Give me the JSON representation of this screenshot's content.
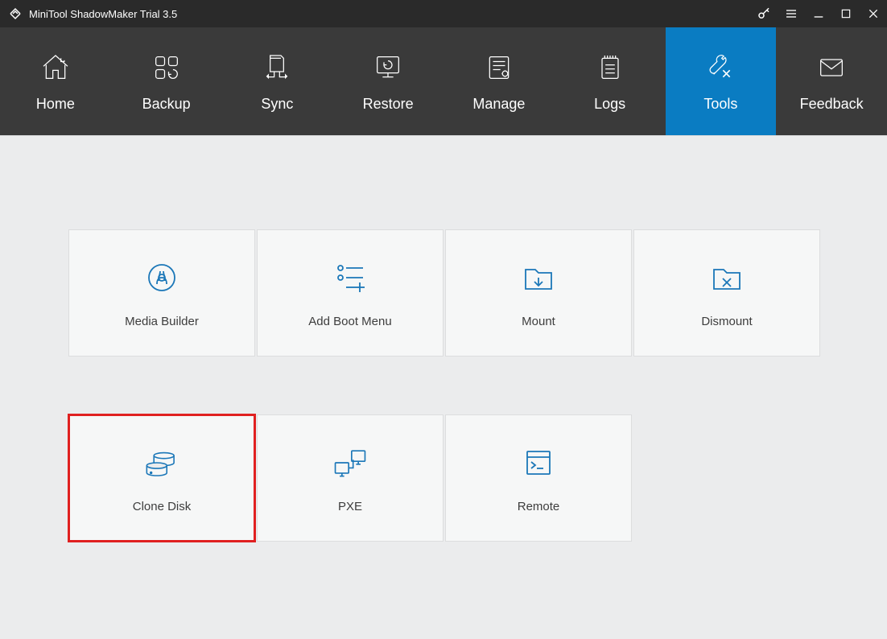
{
  "titlebar": {
    "title": "MiniTool ShadowMaker Trial 3.5"
  },
  "nav": {
    "items": [
      {
        "label": "Home"
      },
      {
        "label": "Backup"
      },
      {
        "label": "Sync"
      },
      {
        "label": "Restore"
      },
      {
        "label": "Manage"
      },
      {
        "label": "Logs"
      },
      {
        "label": "Tools"
      },
      {
        "label": "Feedback"
      }
    ],
    "active_index": 6
  },
  "tools": {
    "items": [
      {
        "label": "Media Builder"
      },
      {
        "label": "Add Boot Menu"
      },
      {
        "label": "Mount"
      },
      {
        "label": "Dismount"
      },
      {
        "label": "Clone Disk"
      },
      {
        "label": "PXE"
      },
      {
        "label": "Remote"
      }
    ],
    "highlighted_index": 4
  }
}
